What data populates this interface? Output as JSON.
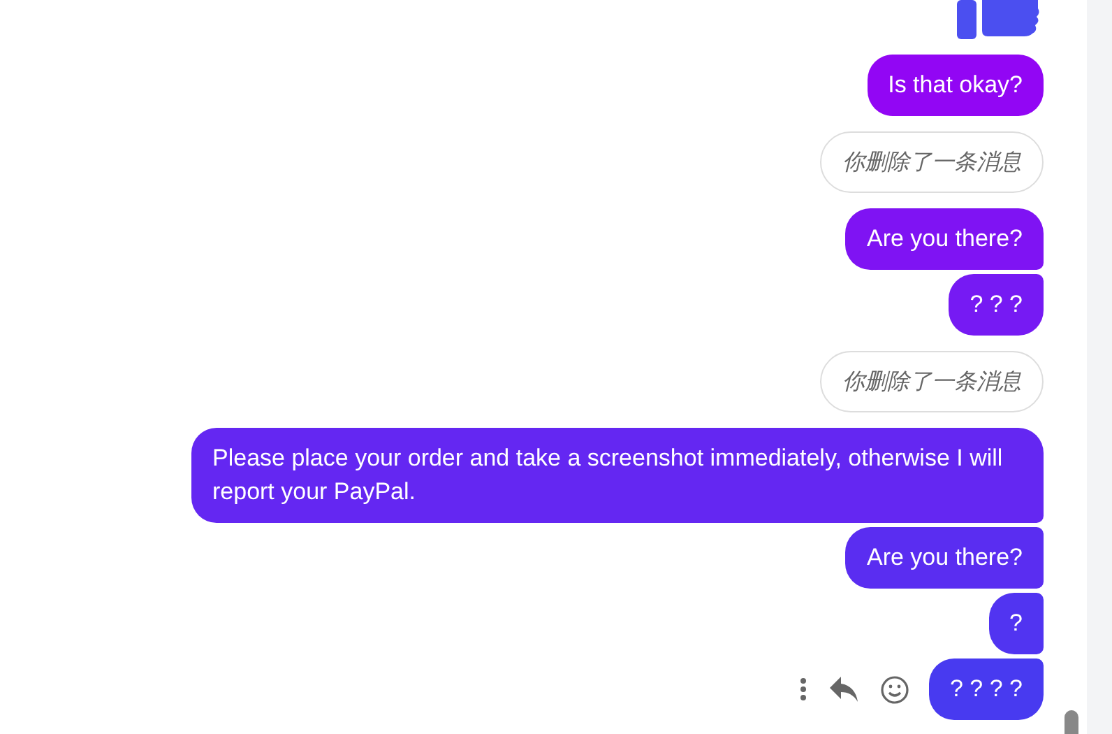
{
  "messages": [
    {
      "kind": "sticker"
    },
    {
      "kind": "text",
      "text": "Is that okay?"
    },
    {
      "kind": "deleted",
      "text": "你删除了一条消息"
    },
    {
      "kind": "text",
      "text": "Are you there?"
    },
    {
      "kind": "text",
      "text": "? ? ?"
    },
    {
      "kind": "deleted",
      "text": "你删除了一条消息"
    },
    {
      "kind": "text",
      "text": "Please place your order and take a screenshot immediately, otherwise I will report your PayPal."
    },
    {
      "kind": "text",
      "text": "Are you there?"
    },
    {
      "kind": "text",
      "text": "?"
    },
    {
      "kind": "text",
      "text": "? ? ? ?",
      "hovered": true
    }
  ]
}
